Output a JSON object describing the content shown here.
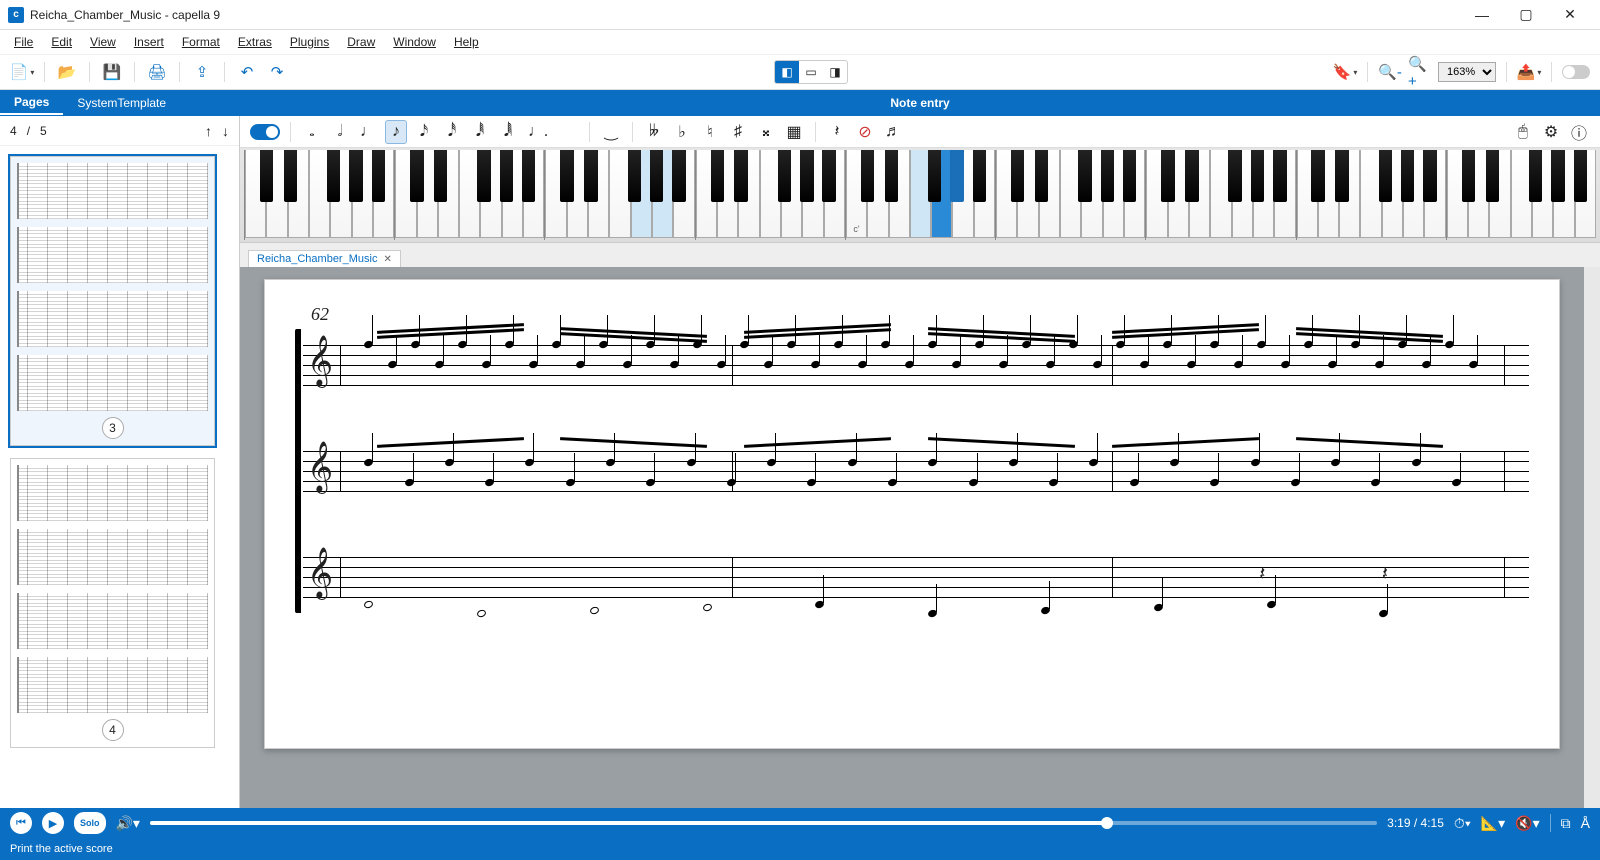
{
  "window": {
    "title": "Reicha_Chamber_Music  - capella 9"
  },
  "menu": [
    "File",
    "Edit",
    "View",
    "Insert",
    "Format",
    "Extras",
    "Plugins",
    "Draw",
    "Window",
    "Help"
  ],
  "toolbar": {
    "zoom": "163%"
  },
  "leftTabs": {
    "pages": "Pages",
    "systemTemplate": "SystemTemplate"
  },
  "pager": {
    "current": "4",
    "sep": " / ",
    "total": "5"
  },
  "thumbs": [
    {
      "num": "3",
      "active": true
    },
    {
      "num": "4",
      "active": false
    }
  ],
  "noteEntry": {
    "title": "Note entry"
  },
  "piano": {
    "middleC": "c'"
  },
  "docTab": {
    "name": "Reicha_Chamber_Music"
  },
  "score": {
    "measureStart": "62"
  },
  "playback": {
    "solo": "Solo",
    "position": "3:19",
    "duration": "4:15",
    "progressPct": 78
  },
  "status": {
    "hint": "Print the active score"
  }
}
